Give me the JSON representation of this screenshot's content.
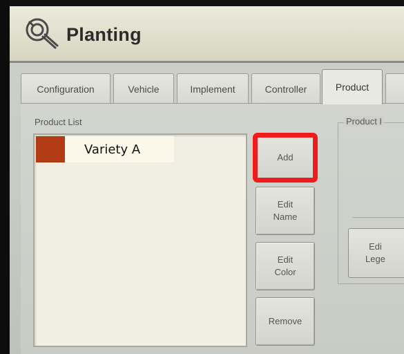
{
  "window": {
    "title": "Planting",
    "icon": "wrench-gear-icon"
  },
  "tabs": [
    {
      "label": "Configuration",
      "active": false
    },
    {
      "label": "Vehicle",
      "active": false
    },
    {
      "label": "Implement",
      "active": false
    },
    {
      "label": "Controller",
      "active": false
    },
    {
      "label": "Product",
      "active": true
    }
  ],
  "product_list": {
    "label": "Product List",
    "items": [
      {
        "name": "Variety A",
        "color": "#b23a14"
      }
    ]
  },
  "buttons": {
    "add": "Add",
    "edit_name": "Edit\nName",
    "edit_color": "Edit\nColor",
    "remove": "Remove"
  },
  "highlight": {
    "target": "Add",
    "color": "#ee1c1c"
  },
  "product_info": {
    "title": "Product I",
    "edit_legend_label": "Edi\nLege"
  }
}
